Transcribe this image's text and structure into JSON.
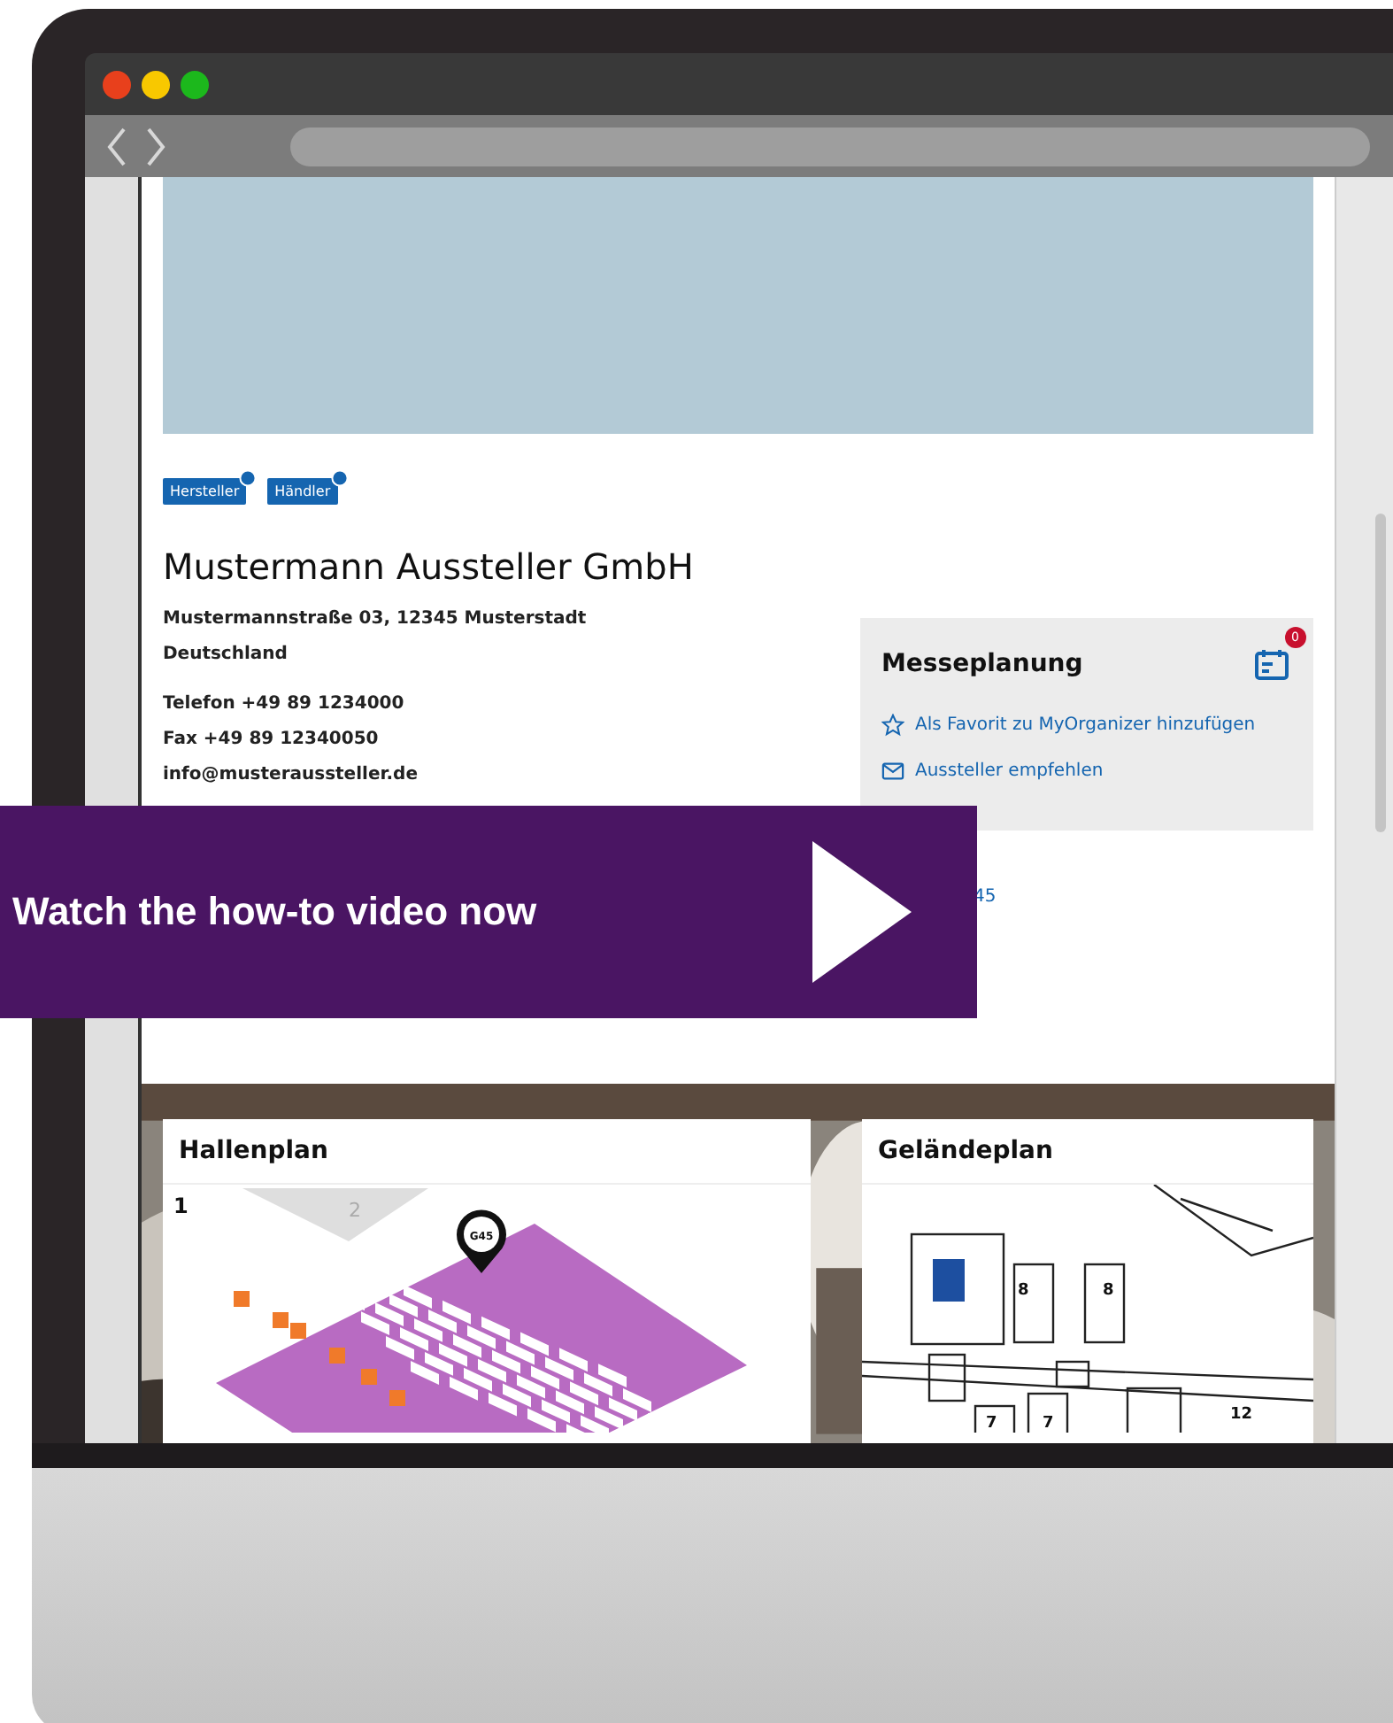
{
  "browser": {
    "window_controls": [
      {
        "color": "#e8401c"
      },
      {
        "color": "#f8c800"
      },
      {
        "color": "#1cb81c"
      }
    ]
  },
  "exhibitor": {
    "tags": [
      {
        "label": "Hersteller"
      },
      {
        "label": "Händler"
      }
    ],
    "name": "Mustermann Aussteller GmbH",
    "address": [
      "Mustermannstraße 03, 12345 Musterstadt",
      "Deutschland"
    ],
    "contact": [
      "Telefon +49 89 1234000",
      "Fax +49 89 12340050",
      "info@musteraussteller.de"
    ]
  },
  "planning": {
    "title": "Messeplanung",
    "badge": "0",
    "actions": [
      {
        "kind": "favorite",
        "label": "Als Favorit zu MyOrganizer hinzufügen"
      },
      {
        "kind": "recommend",
        "label": "Aussteller empfehlen"
      }
    ]
  },
  "stand_link": "45",
  "hall_plan": {
    "title": "Hallenplan",
    "hall": "1",
    "neighbor_hall": "2",
    "booth": "G45"
  },
  "site_plan": {
    "title": "Geländeplan",
    "hall_numbers": [
      "8",
      "8",
      "7",
      "7",
      "12"
    ]
  },
  "video_banner": {
    "text": "Watch the how-to video now"
  }
}
